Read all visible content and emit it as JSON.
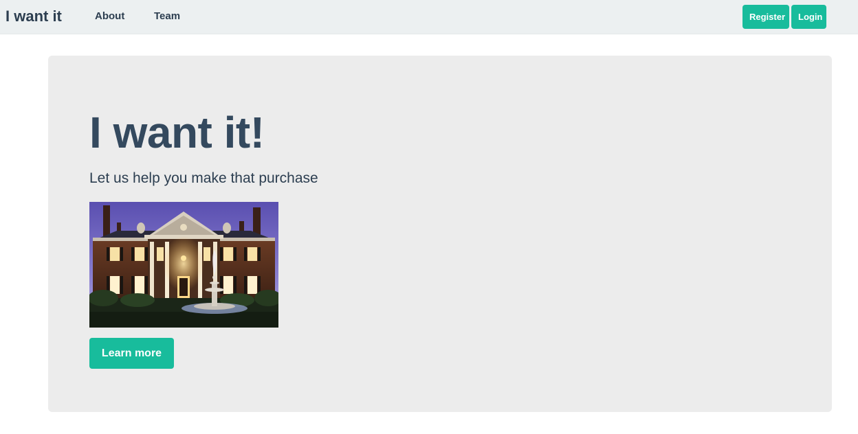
{
  "navbar": {
    "brand": "I want it",
    "links": [
      {
        "label": "About"
      },
      {
        "label": "Team"
      }
    ],
    "register_label": "Register",
    "login_label": "Login"
  },
  "hero": {
    "title": "I want it!",
    "lead": "Let us help you make that purchase",
    "image_subject": "mansion at dusk with illuminated windows and fountain",
    "learn_more_label": "Learn more"
  },
  "colors": {
    "accent": "#18bc9c",
    "navbar_bg": "#ecf0f1",
    "jumbotron_bg": "#ececec",
    "text_dark": "#2c3e50",
    "heading": "#34495e"
  }
}
